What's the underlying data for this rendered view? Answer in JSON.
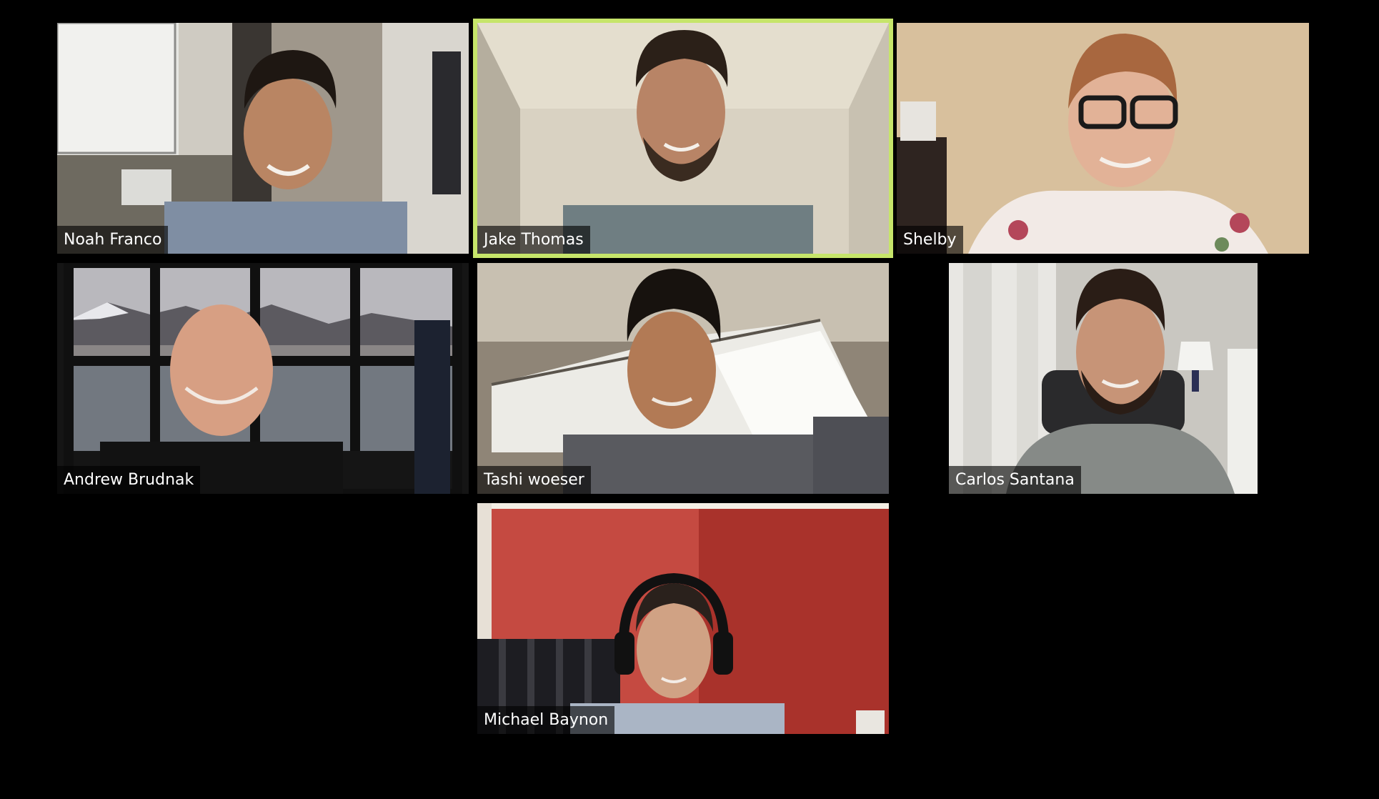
{
  "meeting": {
    "view": "gallery",
    "active_speaker": "Jake Thomas",
    "accent_color": "#c6e56a",
    "participants": [
      {
        "name": "Noah Franco"
      },
      {
        "name": "Jake Thomas"
      },
      {
        "name": "Shelby"
      },
      {
        "name": "Andrew Brudnak"
      },
      {
        "name": "Tashi woeser"
      },
      {
        "name": "Carlos Santana"
      },
      {
        "name": "Michael Baynon"
      }
    ]
  }
}
